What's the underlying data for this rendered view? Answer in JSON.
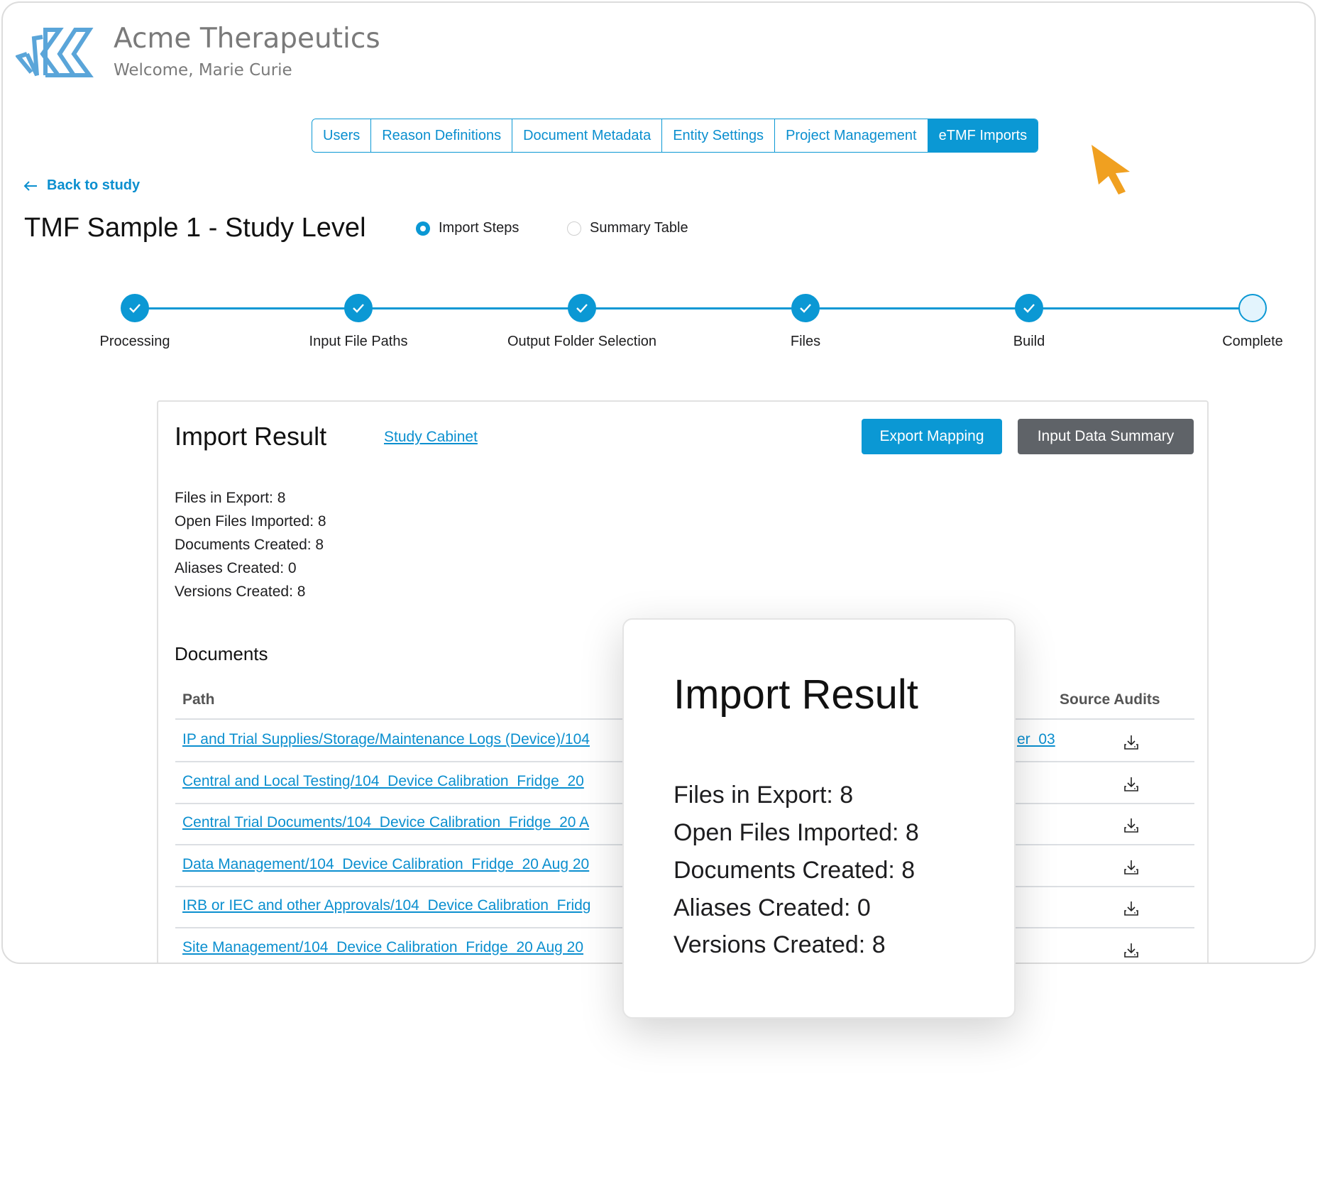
{
  "header": {
    "logo_icon": "acme-k-logo",
    "company": "Acme Therapeutics",
    "welcome": "Welcome, Marie Curie"
  },
  "tabs": [
    {
      "label": "Users",
      "active": false
    },
    {
      "label": "Reason Definitions",
      "active": false
    },
    {
      "label": "Document Metadata",
      "active": false
    },
    {
      "label": "Entity Settings",
      "active": false
    },
    {
      "label": "Project Management",
      "active": false
    },
    {
      "label": "eTMF Imports",
      "active": true
    }
  ],
  "back_link": "Back to study",
  "page_title": "TMF Sample 1 - Study Level",
  "view_options": [
    {
      "label": "Import Steps",
      "selected": true
    },
    {
      "label": "Summary Table",
      "selected": false
    }
  ],
  "steps": [
    {
      "label": "Processing",
      "done": true
    },
    {
      "label": "Input File Paths",
      "done": true
    },
    {
      "label": "Output Folder Selection",
      "done": true
    },
    {
      "label": "Files",
      "done": true
    },
    {
      "label": "Build",
      "done": true
    },
    {
      "label": "Complete",
      "done": false
    }
  ],
  "result": {
    "title": "Import Result",
    "cabinet_link": "Study Cabinet",
    "export_button": "Export Mapping",
    "summary_button": "Input Data Summary",
    "stats": [
      "Files in Export: 8",
      "Open Files Imported: 8",
      "Documents Created: 8",
      "Aliases Created: 0",
      "Versions Created: 8"
    ],
    "documents_heading": "Documents",
    "columns": {
      "path": "Path",
      "audits": "Source Audits"
    },
    "rows": [
      {
        "path": "IP and Trial Supplies/Storage/Maintenance Logs (Device)/104",
        "tail": "er_03"
      },
      {
        "path": "Central and Local Testing/104_Device Calibration_Fridge_20",
        "tail": ""
      },
      {
        "path": "Central Trial Documents/104_Device Calibration_Fridge_20 A",
        "tail": ""
      },
      {
        "path": "Data Management/104_Device Calibration_Fridge_20 Aug 20",
        "tail": ""
      },
      {
        "path": "IRB or IEC and other Approvals/104_Device Calibration_Fridg",
        "tail": ""
      },
      {
        "path": "Site Management/104_Device Calibration_Fridge_20 Aug 20",
        "tail": ""
      }
    ]
  },
  "overlay": {
    "title": "Import Result",
    "stats": [
      "Files in Export: 8",
      "Open Files Imported: 8",
      "Documents Created: 8",
      "Aliases Created: 0",
      "Versions Created: 8"
    ]
  },
  "colors": {
    "accent": "#0b98d4",
    "secondary_button": "#5f6368",
    "cursor": "#f0a020",
    "logo": "#5aa5d9"
  }
}
